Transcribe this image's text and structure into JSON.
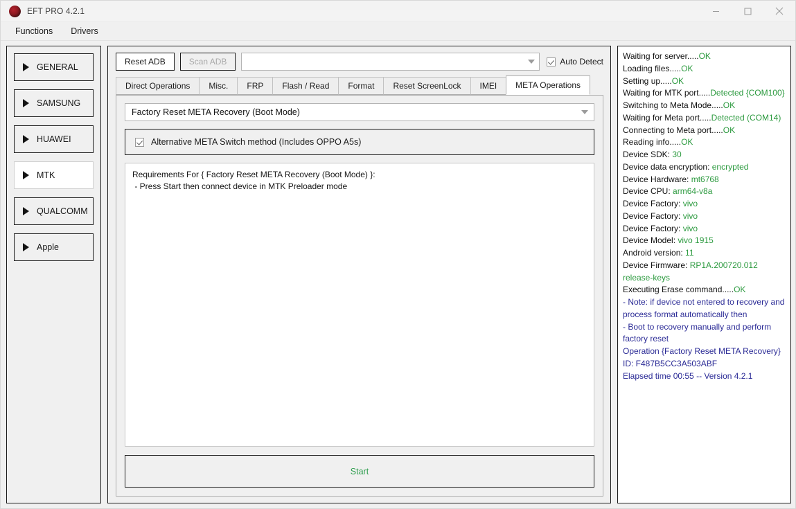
{
  "window": {
    "title": "EFT PRO 4.2.1",
    "logo_icon": "eft-logo-icon",
    "minimize_label": "minimize-icon",
    "maximize_label": "maximize-icon",
    "close_label": "close-icon"
  },
  "menubar": {
    "items": [
      {
        "label": "Functions"
      },
      {
        "label": "Drivers"
      }
    ]
  },
  "sidebar": {
    "items": [
      {
        "label": "GENERAL",
        "active": false
      },
      {
        "label": "SAMSUNG",
        "active": false
      },
      {
        "label": "HUAWEI",
        "active": false
      },
      {
        "label": "MTK",
        "active": true
      },
      {
        "label": "QUALCOMM",
        "active": false
      },
      {
        "label": "Apple",
        "active": false
      }
    ]
  },
  "toolbar": {
    "reset_adb_label": "Reset ADB",
    "scan_adb_label": "Scan ADB",
    "device_combo_value": "",
    "device_combo_placeholder": "",
    "auto_detect_label": "Auto Detect",
    "auto_detect_checked": true
  },
  "tabs": [
    {
      "label": "Direct Operations",
      "active": false
    },
    {
      "label": "Misc.",
      "active": false
    },
    {
      "label": "FRP",
      "active": false
    },
    {
      "label": "Flash / Read",
      "active": false
    },
    {
      "label": "Format",
      "active": false
    },
    {
      "label": "Reset ScreenLock",
      "active": false
    },
    {
      "label": "IMEI",
      "active": false
    },
    {
      "label": "META Operations",
      "active": true
    }
  ],
  "meta_page": {
    "operation_combo_value": "Factory Reset META Recovery (Boot Mode)",
    "alt_switch_label": "Alternative META Switch method (Includes OPPO A5s)",
    "alt_switch_checked": true,
    "requirements_text": "Requirements For { Factory Reset META Recovery (Boot Mode) }:\n - Press Start then connect device in MTK Preloader mode",
    "start_label": "Start"
  },
  "log": {
    "lines": [
      {
        "label": "Waiting for server.....",
        "value": "OK",
        "value_color": "green"
      },
      {
        "label": "Loading files.....",
        "value": "OK",
        "value_color": "green"
      },
      {
        "label": "Setting up.....",
        "value": "OK",
        "value_color": "green"
      },
      {
        "label": "Waiting for MTK port.....",
        "value": "Detected {COM100}",
        "value_color": "green"
      },
      {
        "label": "Switching to Meta Mode.....",
        "value": "OK",
        "value_color": "green"
      },
      {
        "label": "Waiting for Meta port.....",
        "value": "Detected (COM14)",
        "value_color": "green"
      },
      {
        "label": "Connecting to Meta port.....",
        "value": "OK",
        "value_color": "green"
      },
      {
        "label": "Reading info.....",
        "value": "OK",
        "value_color": "green"
      },
      {
        "label": "Device SDK: ",
        "value": "30",
        "value_color": "green"
      },
      {
        "label": "Device data encryption: ",
        "value": "encrypted",
        "value_color": "green"
      },
      {
        "label": "Device Hardware: ",
        "value": "mt6768",
        "value_color": "green"
      },
      {
        "label": "Device CPU: ",
        "value": "arm64-v8a",
        "value_color": "green"
      },
      {
        "label": "Device Factory: ",
        "value": "vivo",
        "value_color": "green"
      },
      {
        "label": "Device Factory: ",
        "value": "vivo",
        "value_color": "green"
      },
      {
        "label": "Device Factory: ",
        "value": "vivo",
        "value_color": "green"
      },
      {
        "label": "Device Model: ",
        "value": "vivo 1915",
        "value_color": "green"
      },
      {
        "label": "Android version: ",
        "value": "11",
        "value_color": "green"
      },
      {
        "label": "Device Firmware: ",
        "value": "RP1A.200720.012 release-keys",
        "value_color": "green"
      },
      {
        "label": "Executing Erase command.....",
        "value": "OK",
        "value_color": "green"
      },
      {
        "label": "",
        "value": "- Note: if device not entered to recovery and process format automatically then",
        "value_color": "blue"
      },
      {
        "label": "",
        "value": "- Boot to recovery manually and perform factory reset",
        "value_color": "blue"
      },
      {
        "label": "",
        "value": "Operation {Factory Reset META Recovery}",
        "value_color": "blue"
      },
      {
        "label": "",
        "value": "ID: F487B5CC3A503ABF",
        "value_color": "blue"
      },
      {
        "label": "",
        "value": "Elapsed time 00:55 -- Version 4.2.1",
        "value_color": "blue"
      }
    ]
  },
  "colors": {
    "accent_green": "#2c9a3f",
    "accent_blue": "#2b2b96",
    "window_bg": "#f0f0f0",
    "border": "#1b1b1b"
  }
}
